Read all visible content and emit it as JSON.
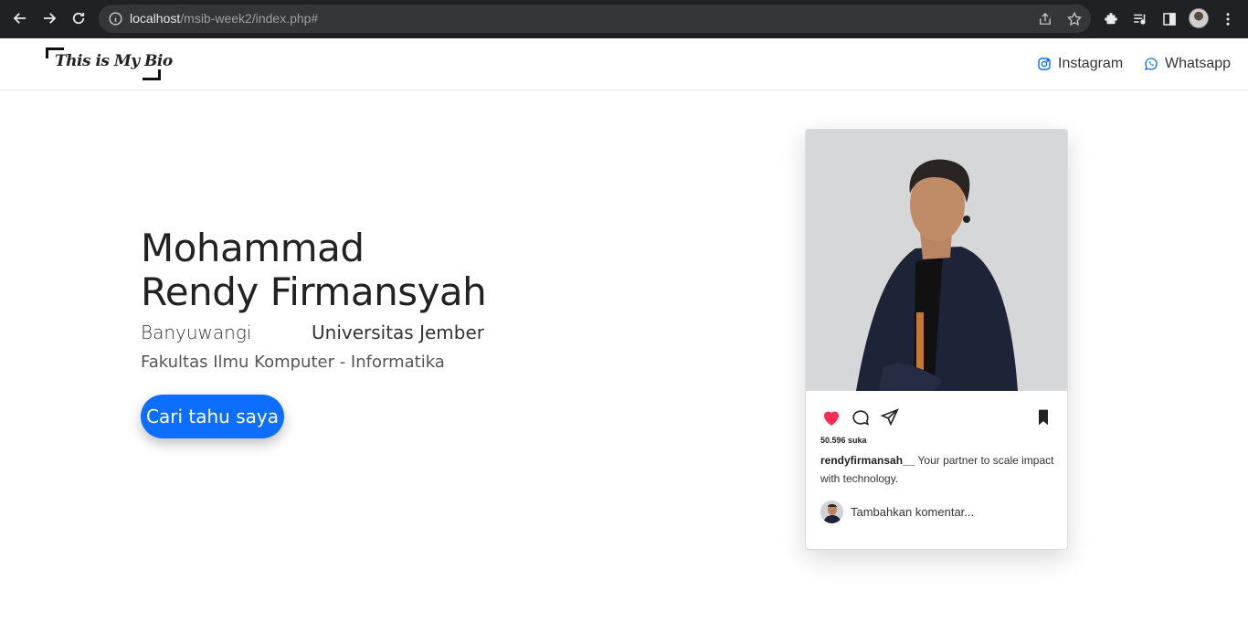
{
  "browser": {
    "url_host": "localhost",
    "url_path": "/msib-week2/index.php#"
  },
  "navbar": {
    "brand": "This is My Bio",
    "links": [
      {
        "label": "Instagram",
        "icon": "instagram-icon"
      },
      {
        "label": "Whatsapp",
        "icon": "whatsapp-icon"
      }
    ]
  },
  "hero": {
    "name_line1": "Mohammad",
    "name_line2": "Rendy Firmansyah",
    "city": "Banyuwangi",
    "university": "Universitas Jember",
    "faculty": "Fakultas Ilmu Komputer - Informatika",
    "cta": "Cari tahu saya"
  },
  "card": {
    "likes": "50.596 suka",
    "username": "rendyfirmansah__",
    "caption": " Your partner to scale impact with technology.",
    "comment_placeholder": "Tambahkan komentar...",
    "heart_color": "#ff2d55"
  }
}
